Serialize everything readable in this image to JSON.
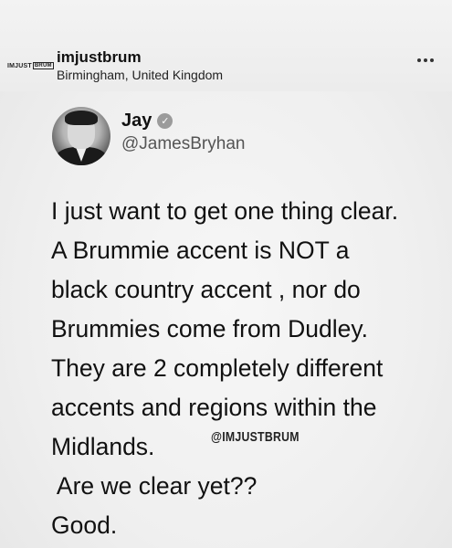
{
  "post": {
    "logo_text_a": "IMJUST",
    "logo_text_b": "BRUM",
    "account_name": "imjustbrum",
    "location": "Birmingham, United Kingdom"
  },
  "tweet": {
    "name": "Jay",
    "verified_mark": "✓",
    "handle": "@JamesBryhan",
    "lines": [
      "I just want to get one thing clear.",
      "A Brummie accent is NOT a",
      "black country accent , nor do",
      "Brummies come from Dudley.",
      "They are 2 completely different",
      "accents and regions within the",
      "Midlands.",
      " Are we clear yet??",
      "Good."
    ]
  },
  "watermark": "@IMJUSTBRUM",
  "icons": {
    "more": "more-horizontal-icon",
    "verified": "verified-badge-icon"
  },
  "colors": {
    "text": "#111111",
    "handle": "#555555",
    "verified_badge": "#9b9b9b",
    "background": "#efefef"
  }
}
